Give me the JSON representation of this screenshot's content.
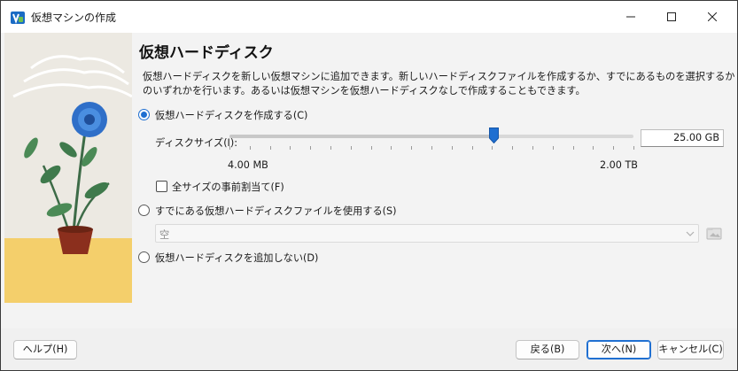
{
  "window": {
    "title": "仮想マシンの作成",
    "controls": {
      "minimize": "minimize",
      "maximize": "maximize",
      "close": "close"
    }
  },
  "page": {
    "heading": "仮想ハードディスク",
    "description_lines": [
      "仮想ハードディスクを新しい仮想マシンに追加できます。新しいハードディスクファイルを作成するか、すでにあるものを選択するか",
      "のいずれかを行います。あるいは仮想マシンを仮想ハードディスクなしで作成することもできます。"
    ]
  },
  "options": {
    "create_new": {
      "label": "仮想ハードディスクを作成する(C)",
      "selected": true
    },
    "use_existing": {
      "label": "すでにある仮想ハードディスクファイルを使用する(S)",
      "selected": false
    },
    "no_disk": {
      "label": "仮想ハードディスクを追加しない(D)",
      "selected": false
    }
  },
  "disk_size": {
    "label": "ディスクサイズ(I):",
    "value": "25.00 GB",
    "min_label": "4.00 MB",
    "max_label": "2.00 TB",
    "slider_position": 0.655
  },
  "preallocate": {
    "label": "全サイズの事前割当て(F)",
    "checked": false
  },
  "existing_file": {
    "selected_value": "空",
    "enabled": false
  },
  "buttons": {
    "help": "ヘルプ(H)",
    "back": "戻る(B)",
    "next": "次へ(N)",
    "cancel": "キャンセル(C)"
  },
  "colors": {
    "accent": "#1f6fd1"
  }
}
